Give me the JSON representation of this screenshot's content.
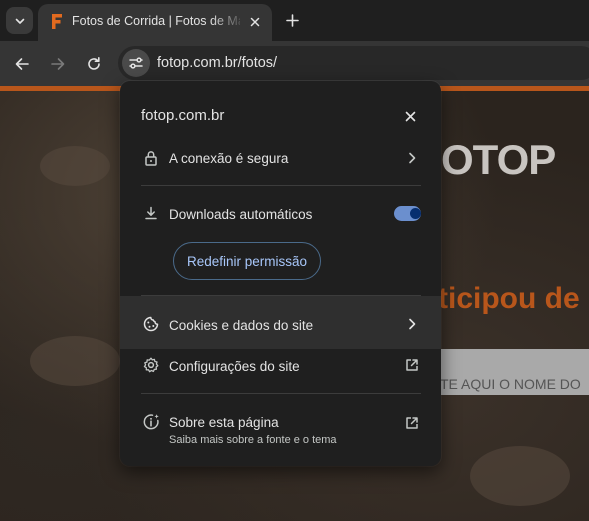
{
  "tab": {
    "title": "Fotos de Corrida | Fotos de Ma"
  },
  "toolbar": {
    "url": "fotop.com.br/fotos/"
  },
  "popup": {
    "host": "fotop.com.br",
    "connection_label": "A conexão é segura",
    "downloads_label": "Downloads automáticos",
    "downloads_enabled": true,
    "reset_button": "Redefinir permissão",
    "cookies_label": "Cookies e dados do site",
    "site_settings_label": "Configurações do site",
    "about_label": "Sobre esta página",
    "about_sublabel": "Saiba mais sobre a fonte e o tema"
  },
  "page": {
    "logo_text": "OTOP",
    "heading": "ticipou de",
    "search_placeholder": "TE AQUI O NOME DO"
  },
  "colors": {
    "accent_orange": "#b8561b",
    "popup_bg": "#1f1f1f",
    "link_blue": "#a8c7fa"
  }
}
